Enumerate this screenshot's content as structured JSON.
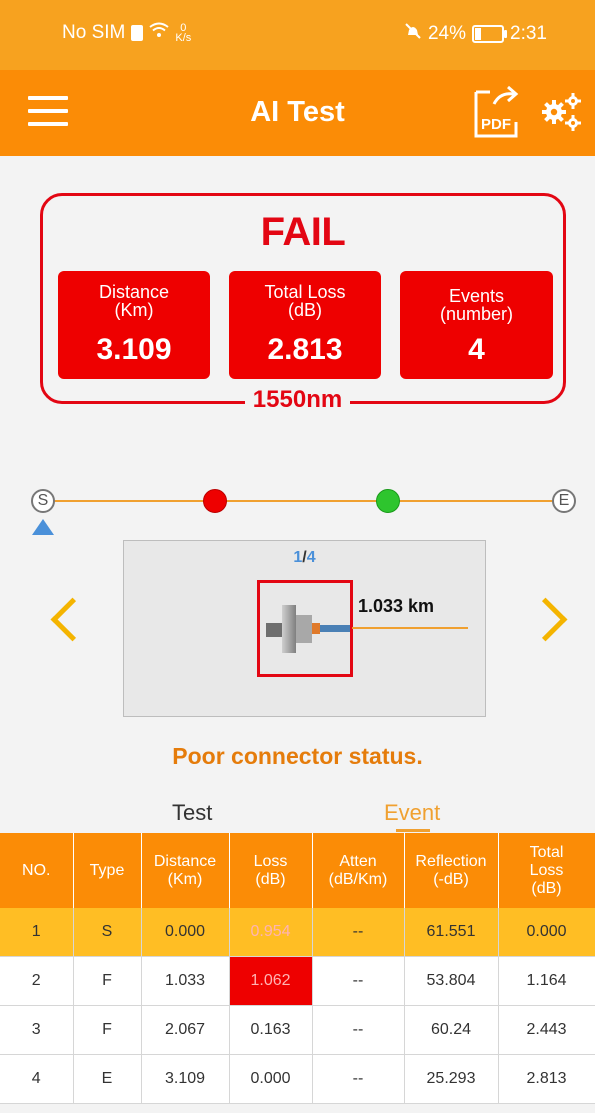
{
  "status_bar": {
    "carrier": "No SIM",
    "net_rate_top": "0",
    "net_rate_unit": "K/s",
    "battery": "24%",
    "battery_level": 0.24,
    "time": "2:31"
  },
  "app_bar": {
    "title": "AI Test",
    "pdf_label": "PDF"
  },
  "summary": {
    "result": "FAIL",
    "cards": [
      {
        "label": "Distance\n(Km)",
        "value": "3.109"
      },
      {
        "label": "Total Loss\n(dB)",
        "value": "2.813"
      },
      {
        "label": "Events\n(number)",
        "value": "4"
      }
    ],
    "wavelength": "1550nm"
  },
  "track": {
    "start": "S",
    "end": "E",
    "dot_colors": [
      "#ee0000",
      "#2ec52e"
    ]
  },
  "viewer": {
    "page_current": "1",
    "page_sep": "/",
    "page_total": "4",
    "distance": "1.033 km"
  },
  "status_message": "Poor connector status.",
  "tabs": {
    "test": "Test",
    "event": "Event"
  },
  "table": {
    "headers": [
      "NO.",
      "Type",
      "Distance\n(Km)",
      "Loss\n(dB)",
      "Atten\n(dB/Km)",
      "Reflection\n(-dB)",
      "Total\nLoss\n(dB)"
    ],
    "rows": [
      [
        "1",
        "S",
        "0.000",
        "0.954",
        "--",
        "61.551",
        "0.000"
      ],
      [
        "2",
        "F",
        "1.033",
        "1.062",
        "--",
        "53.804",
        "1.164"
      ],
      [
        "3",
        "F",
        "2.067",
        "0.163",
        "--",
        "60.24",
        "2.443"
      ],
      [
        "4",
        "E",
        "3.109",
        "0.000",
        "--",
        "25.293",
        "2.813"
      ]
    ]
  },
  "colors": {
    "accent": "#fb8c06",
    "fail": "#e30613",
    "selected_row": "#ffbe24"
  }
}
